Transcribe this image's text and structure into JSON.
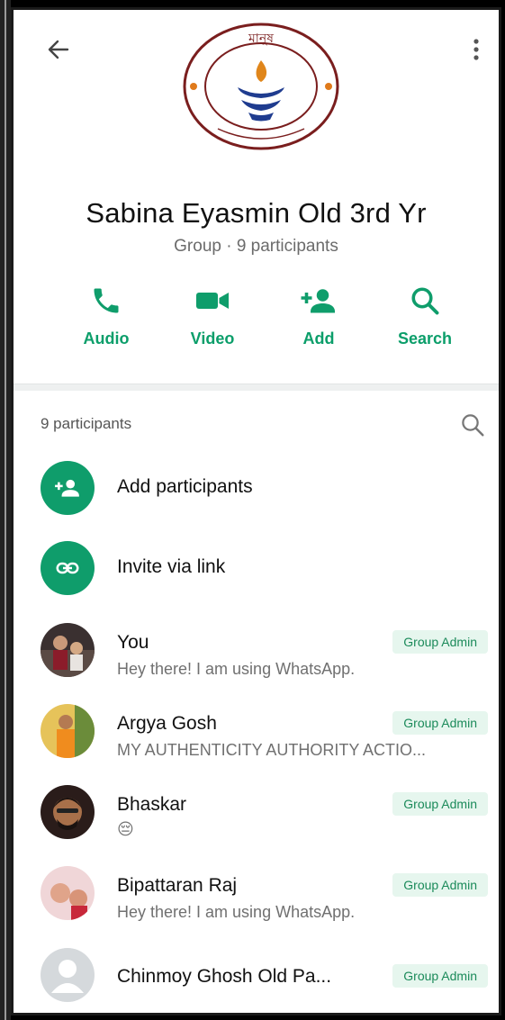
{
  "header": {
    "group_name": "Sabina Eyasmin Old 3rd Yr",
    "subtitle": "Group · 9 participants",
    "logo_text": "মানুষ"
  },
  "actions": [
    {
      "label": "Audio",
      "icon": "phone-icon"
    },
    {
      "label": "Video",
      "icon": "video-camera-icon"
    },
    {
      "label": "Add",
      "icon": "add-person-icon"
    },
    {
      "label": "Search",
      "icon": "search-icon"
    }
  ],
  "participants_header": "9 participants",
  "special_rows": [
    {
      "label": "Add participants",
      "icon": "add-person-icon"
    },
    {
      "label": "Invite via link",
      "icon": "link-icon"
    }
  ],
  "participants": [
    {
      "name": "You",
      "status": "Hey there! I am using WhatsApp.",
      "badge": "Group Admin"
    },
    {
      "name": "Argya Gosh",
      "status": "MY AUTHENTICITY AUTHORITY ACTIO...",
      "badge": "Group Admin"
    },
    {
      "name": "Bhaskar",
      "status": "😔",
      "badge": "Group Admin"
    },
    {
      "name": "Bipattaran Raj",
      "status": "Hey there! I am using WhatsApp.",
      "badge": "Group Admin"
    },
    {
      "name": "Chinmoy Ghosh Old Pa...",
      "status": "",
      "badge": "Group Admin"
    }
  ],
  "colors": {
    "accent": "#0f9d6b",
    "badge_bg": "#e6f6ee",
    "badge_text": "#1b8a5a"
  }
}
